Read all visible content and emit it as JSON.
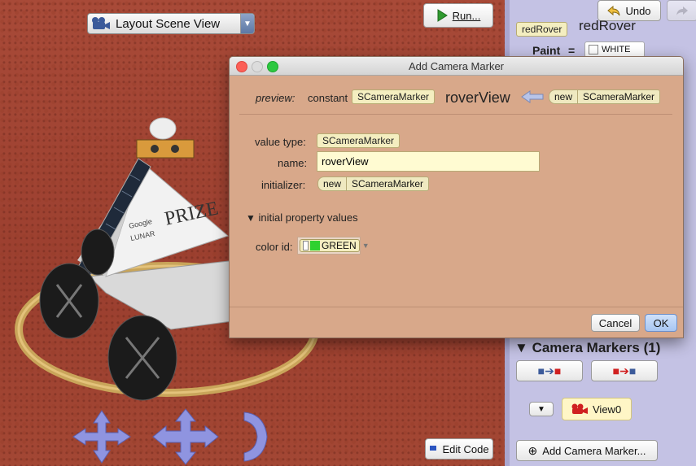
{
  "scene": {
    "view_select": "Layout Scene View",
    "run_button": "Run...",
    "edit_code_button": "Edit Code",
    "xprize_text": "PRIZE",
    "google_text": "Google",
    "lunar_text": "LUNAR"
  },
  "panel": {
    "undo_button": "Undo",
    "header_chip": "redRover",
    "header_partial": "redRover",
    "paint_label": "Paint",
    "equals": "=",
    "paint_value": "WHITE",
    "camera_markers_title": "Camera Markers (1)",
    "marker_name": "View0",
    "add_marker_button": "Add Camera Marker..."
  },
  "dialog": {
    "title": "Add Camera Marker",
    "preview_label": "preview:",
    "constant_label": "constant",
    "type_chip": "SCameraMarker",
    "var_name": "roverView",
    "new_label": "new",
    "new_type": "SCameraMarker",
    "value_type_label": "value type:",
    "value_type": "SCameraMarker",
    "name_label": "name:",
    "name_value": "roverView",
    "initializer_label": "initializer:",
    "init_new": "new",
    "init_type": "SCameraMarker",
    "initial_props_label": "initial property values",
    "color_id_label": "color id:",
    "color_value": "GREEN",
    "cancel_button": "Cancel",
    "ok_button": "OK"
  },
  "colors": {
    "dialog_bg": "#d8a88a",
    "panel_bg": "#c4c2e4",
    "terrain": "#a34734",
    "green_swatch": "#2fd12f"
  }
}
